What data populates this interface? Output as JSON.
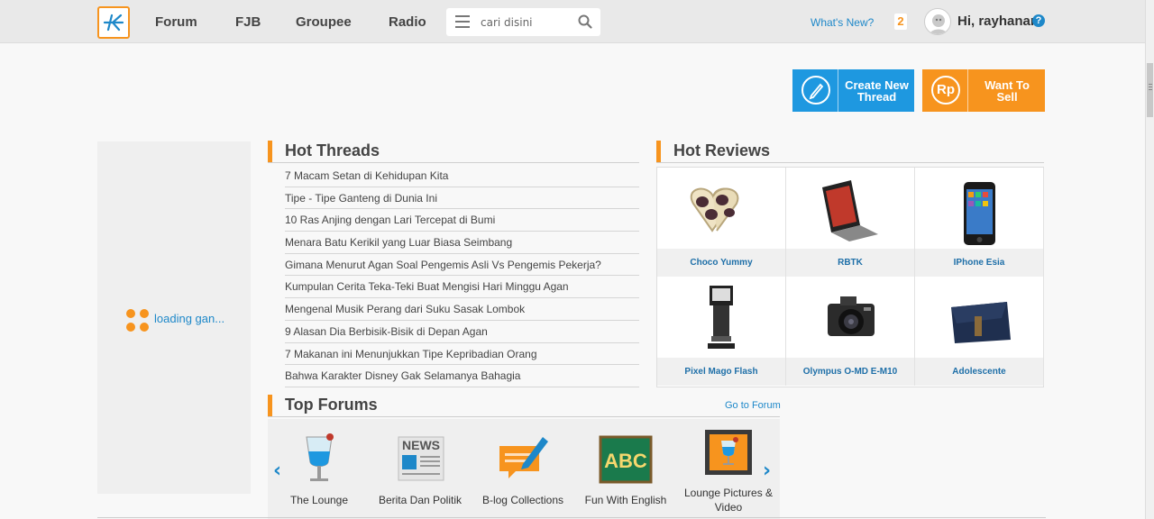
{
  "header": {
    "nav": [
      "Forum",
      "FJB",
      "Groupee",
      "Radio"
    ],
    "search_placeholder": "cari disini",
    "whats_new": "What's New?",
    "notification_count": "2",
    "greeting": "Hi, rayhanar",
    "help": "?"
  },
  "actions": {
    "create_thread": "Create New Thread",
    "want_to_sell": "Want To Sell",
    "currency_icon_text": "Rp"
  },
  "left_panel": {
    "loading": "loading gan..."
  },
  "hot_threads": {
    "title": "Hot Threads",
    "items": [
      "7 Macam Setan di Kehidupan Kita",
      "Tipe - Tipe Ganteng di Dunia Ini",
      "10 Ras Anjing dengan Lari Tercepat di Bumi",
      "Menara Batu Kerikil yang Luar Biasa Seimbang",
      "Gimana Menurut Agan Soal Pengemis Asli Vs Pengemis Pekerja?",
      "Kumpulan Cerita Teka-Teki Buat Mengisi Hari Minggu Agan",
      "Mengenal Musik Perang dari Suku Sasak Lombok",
      "9 Alasan Dia Berbisik-Bisik di Depan Agan",
      "7 Makanan ini Menunjukkan Tipe Kepribadian Orang",
      "Bahwa Karakter Disney Gak Selamanya Bahagia"
    ]
  },
  "hot_reviews": {
    "title": "Hot Reviews",
    "items": [
      "Choco Yummy",
      "RBTK",
      "IPhone Esia",
      "Pixel Mago Flash",
      "Olympus O-MD E-M10",
      "Adolescente"
    ]
  },
  "top_forums": {
    "title": "Top Forums",
    "go_to_forum": "Go to Forum",
    "items": [
      "The Lounge",
      "Berita Dan Politik",
      "B-log Collections",
      "Fun With English",
      "Lounge Pictures & Video"
    ],
    "news_icon_text": "NEWS",
    "abc_icon_text": "ABC"
  },
  "colors": {
    "accent": "#f7941e",
    "primary": "#1e98e0",
    "link": "#1e88c9"
  }
}
